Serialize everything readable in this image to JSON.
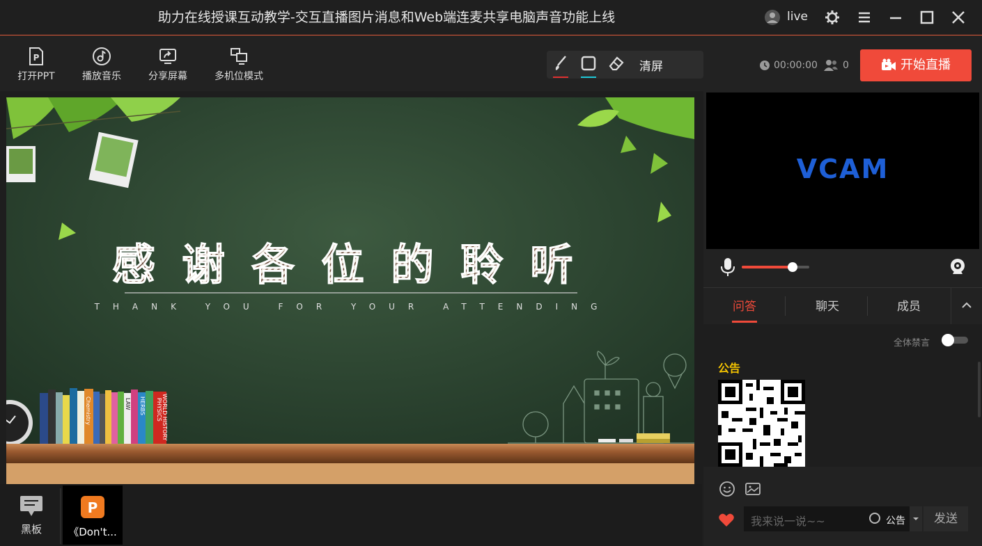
{
  "window": {
    "title": "助力在线授课互动教学-交互直播图片消息和Web端连麦共享电脑声音功能上线",
    "user_name": "live"
  },
  "toolbar": {
    "open_ppt": "打开PPT",
    "play_music": "播放音乐",
    "share_screen": "分享屏幕",
    "multi_camera": "多机位模式",
    "clear_screen": "清屏",
    "timer": "00:00:00",
    "viewer_count": "0",
    "start_live": "开始直播"
  },
  "slide": {
    "heading": "感谢各位的聆听",
    "subheading": "THANK YOU FOR YOUR ATTENDING",
    "book_spines": [
      "PHYSICS",
      "WORLD HISTORY",
      "HERBS",
      "LAW",
      "Chemistry"
    ]
  },
  "bottombar": {
    "blackboard": "黑板",
    "doc_tab": "《Don't..."
  },
  "video": {
    "camera_label": "VCAM",
    "volume_level": 0.75
  },
  "tabs": [
    "问答",
    "聊天",
    "成员"
  ],
  "chat": {
    "mute_all_label": "全体禁言",
    "notice_title": "公告",
    "input_placeholder": "我来说一说~~",
    "notice_option": "公告",
    "send_label": "发送"
  },
  "colors": {
    "accent": "#f04a3a",
    "notice": "#f5c400",
    "camera_text": "#1e5fd6"
  }
}
